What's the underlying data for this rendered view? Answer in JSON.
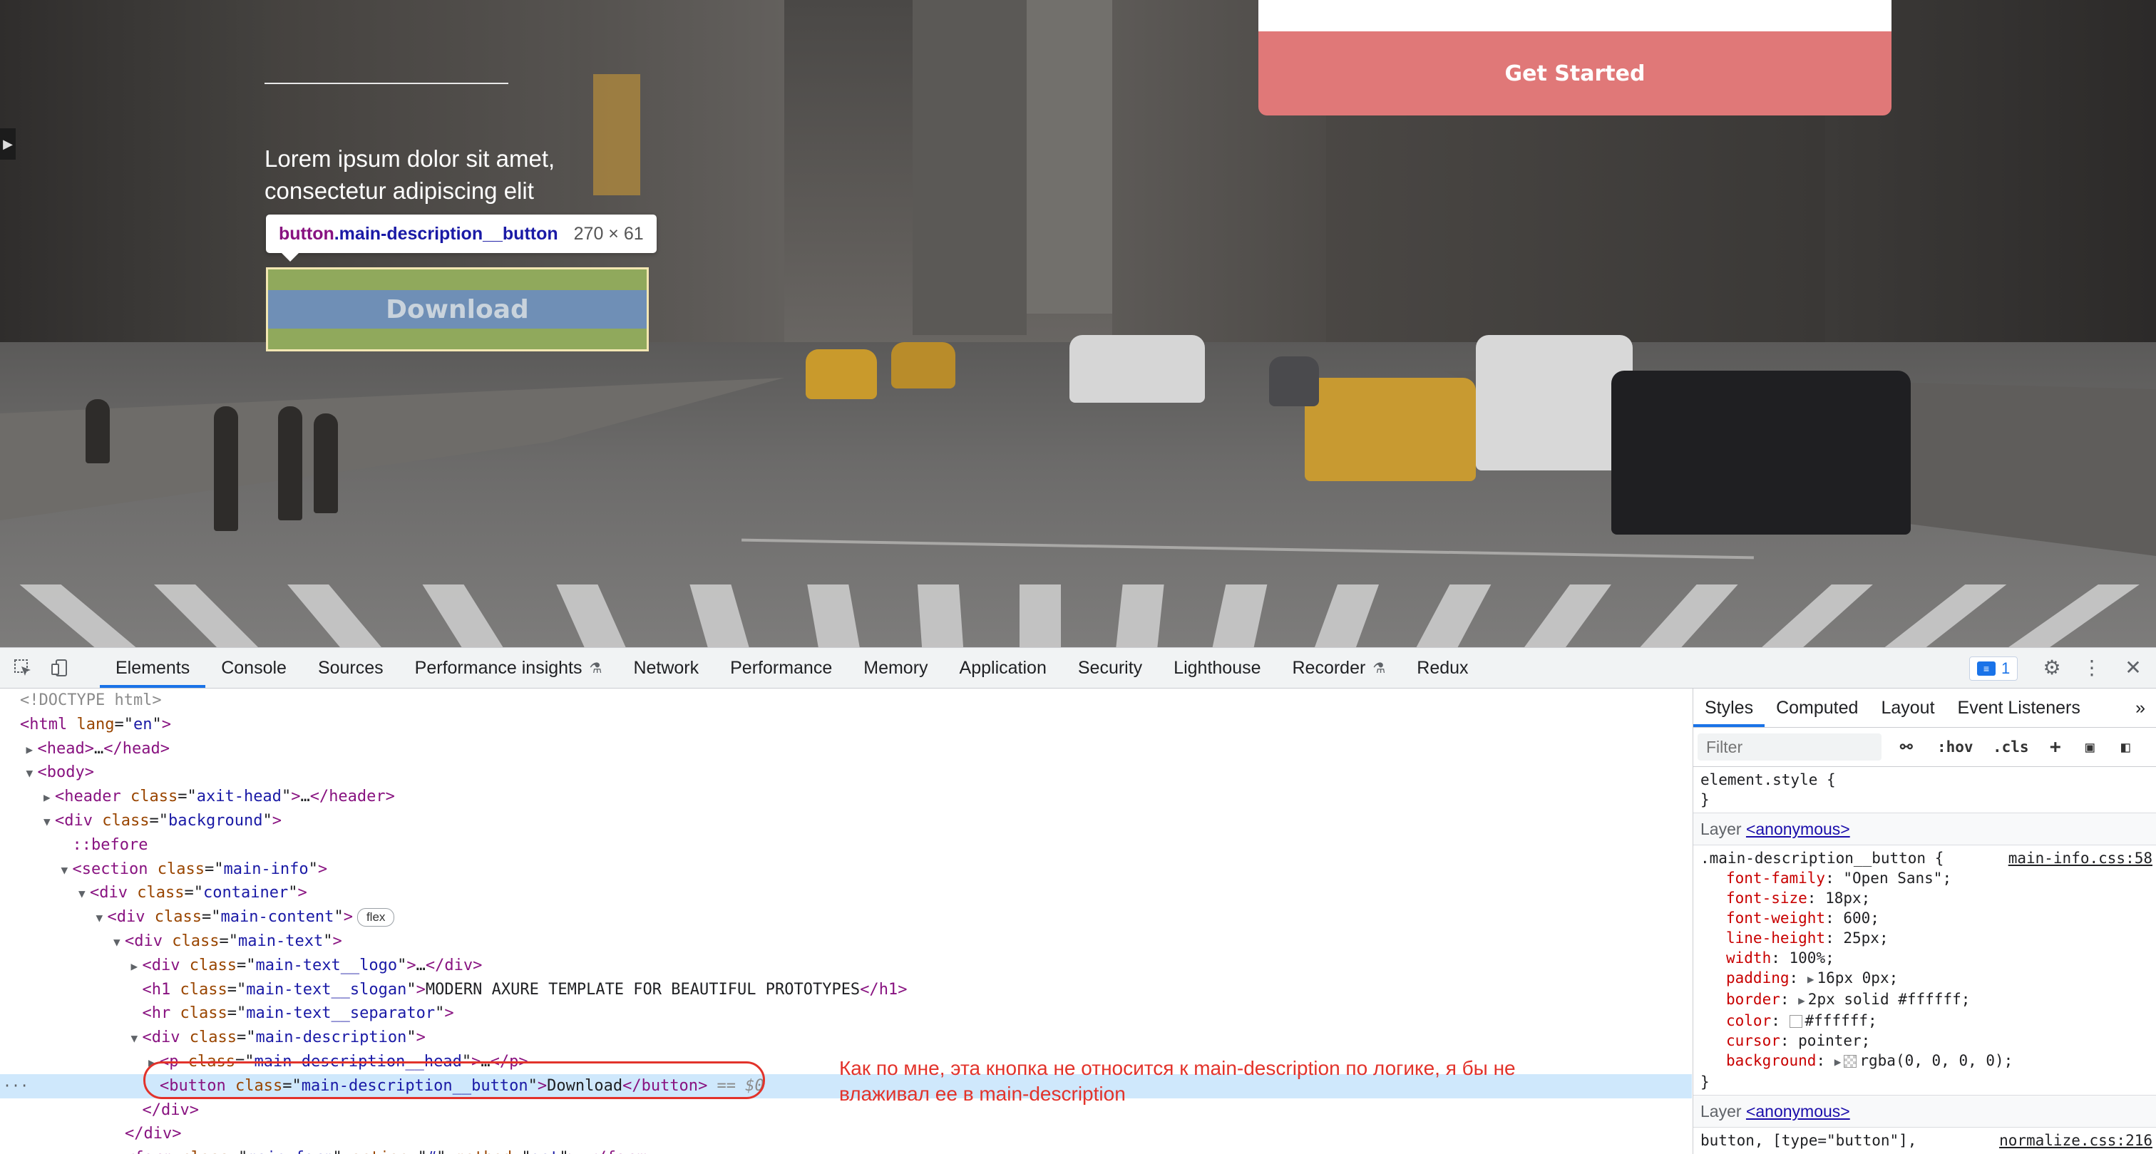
{
  "hero": {
    "description": "Lorem ipsum dolor sit amet, consectetur adipiscing elit",
    "tooltip_tag": "button",
    "tooltip_class": ".main-description__button",
    "tooltip_size": "270 × 61",
    "download_label": "Download",
    "get_started_label": "Get Started"
  },
  "devtools": {
    "tabs": [
      "Elements",
      "Console",
      "Sources",
      "Performance insights",
      "Network",
      "Performance",
      "Memory",
      "Application",
      "Security",
      "Lighthouse",
      "Recorder",
      "Redux"
    ],
    "active_tab": "Elements",
    "issues_count": "1",
    "dom": [
      {
        "indent": 0,
        "tri": "",
        "html": "doctype",
        "text": "<!DOCTYPE html>"
      },
      {
        "indent": 0,
        "tri": "",
        "tag": "html",
        "attrs": [
          [
            "lang",
            "en"
          ]
        ],
        "close": false
      },
      {
        "indent": 1,
        "tri": "▶",
        "tag": "head",
        "collapsed": true
      },
      {
        "indent": 1,
        "tri": "▼",
        "tag": "body",
        "attrs": [],
        "close": false
      },
      {
        "indent": 2,
        "tri": "▶",
        "tag": "header",
        "attrs": [
          [
            "class",
            "axit-head"
          ]
        ],
        "collapsed": true
      },
      {
        "indent": 2,
        "tri": "▼",
        "tag": "div",
        "attrs": [
          [
            "class",
            "background"
          ]
        ],
        "close": false
      },
      {
        "indent": 3,
        "tri": "",
        "pseudo": "::before"
      },
      {
        "indent": 3,
        "tri": "▼",
        "tag": "section",
        "attrs": [
          [
            "class",
            "main-info"
          ]
        ],
        "close": false
      },
      {
        "indent": 4,
        "tri": "▼",
        "tag": "div",
        "attrs": [
          [
            "class",
            "container"
          ]
        ],
        "close": false
      },
      {
        "indent": 5,
        "tri": "▼",
        "tag": "div",
        "attrs": [
          [
            "class",
            "main-content"
          ]
        ],
        "close": false,
        "badge": "flex"
      },
      {
        "indent": 6,
        "tri": "▼",
        "tag": "div",
        "attrs": [
          [
            "class",
            "main-text"
          ]
        ],
        "close": false
      },
      {
        "indent": 7,
        "tri": "▶",
        "tag": "div",
        "attrs": [
          [
            "class",
            "main-text__logo"
          ]
        ],
        "collapsed": true
      },
      {
        "indent": 7,
        "tri": "",
        "tag": "h1",
        "attrs": [
          [
            "class",
            "main-text__slogan"
          ]
        ],
        "inner": "MODERN AXURE TEMPLATE FOR BEAUTIFUL PROTOTYPES",
        "closetag": true
      },
      {
        "indent": 7,
        "tri": "",
        "tag": "hr",
        "attrs": [
          [
            "class",
            "main-text__separator"
          ]
        ],
        "close": false
      },
      {
        "indent": 7,
        "tri": "▼",
        "tag": "div",
        "attrs": [
          [
            "class",
            "main-description"
          ]
        ],
        "close": false
      },
      {
        "indent": 8,
        "tri": "▶",
        "tag": "p",
        "attrs": [
          [
            "class",
            "main-description__head"
          ]
        ],
        "collapsed": true,
        "struck": true
      },
      {
        "indent": 8,
        "tri": "",
        "tag": "button",
        "attrs": [
          [
            "class",
            "main-description__button"
          ]
        ],
        "inner": "Download",
        "closetag": true,
        "selected": true,
        "suffix": " == $0"
      },
      {
        "indent": 7,
        "tri": "",
        "endtag": "div"
      },
      {
        "indent": 6,
        "tri": "",
        "endtag": "div"
      },
      {
        "indent": 6,
        "tri": "▶",
        "tag": "form",
        "attrs": [
          [
            "class",
            "main-form"
          ],
          [
            "action",
            "#"
          ],
          [
            "method",
            "get"
          ]
        ],
        "collapsed": true
      }
    ],
    "annotation": "Как по мне, эта кнопка не относится к main-description по логике, я бы не влаживал ее в main-description"
  },
  "styles": {
    "tabs": [
      "Styles",
      "Computed",
      "Layout",
      "Event Listeners"
    ],
    "active_tab": "Styles",
    "filter_placeholder": "Filter",
    "tools": [
      ":hov",
      ".cls",
      "+"
    ],
    "element_style_selector": "element.style {",
    "element_style_close": "}",
    "layer_label": "Layer",
    "layer_name": "<anonymous>",
    "rule_selector": ".main-description__button {",
    "rule_source": "main-info.css:58",
    "declarations": [
      {
        "name": "font-family",
        "value": "\"Open Sans\";"
      },
      {
        "name": "font-size",
        "value": "18px;"
      },
      {
        "name": "font-weight",
        "value": "600;"
      },
      {
        "name": "line-height",
        "value": "25px;"
      },
      {
        "name": "width",
        "value": "100%;"
      },
      {
        "name": "padding",
        "value": "16px 0px;",
        "caret": true
      },
      {
        "name": "border",
        "value": "2px solid  #ffffff;",
        "caret": true,
        "swatch": "white"
      },
      {
        "name": "color",
        "value": "#ffffff;",
        "swatch": "white"
      },
      {
        "name": "cursor",
        "value": "pointer;"
      },
      {
        "name": "background",
        "value": "rgba(0, 0, 0, 0);",
        "caret": true,
        "swatch": "check"
      }
    ],
    "rule_close": "}",
    "layer2_name": "<anonymous>",
    "rule2_selector": "button, [type=\"button\"],",
    "rule2_source": "normalize.css:216"
  }
}
